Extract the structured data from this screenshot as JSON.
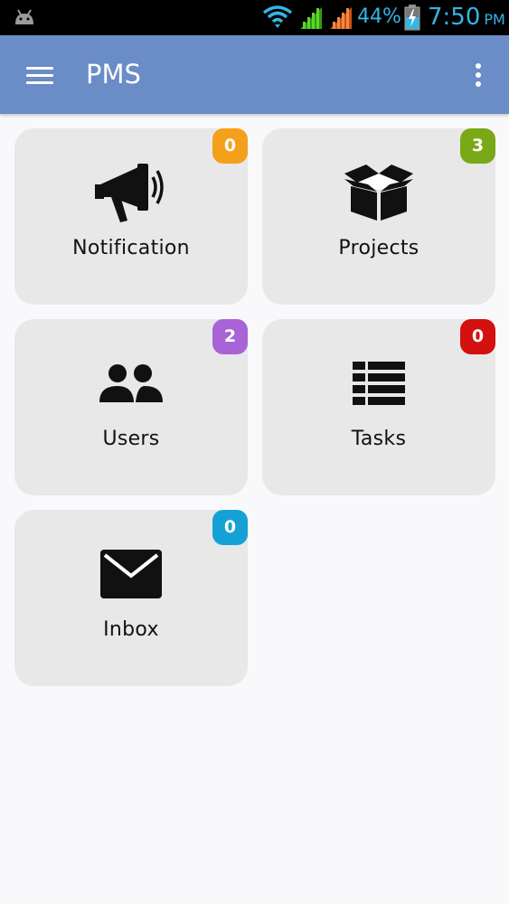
{
  "status_bar": {
    "battery_percent": "44%",
    "time": "7:50",
    "ampm": "PM",
    "icons": [
      "android-icon",
      "wifi-icon",
      "signal-icon",
      "signal-icon",
      "battery-charging-icon"
    ]
  },
  "toolbar": {
    "title": "PMS",
    "menu_icon": "hamburger-menu-icon",
    "overflow_icon": "more-vert-icon",
    "color": "#6a8cc7"
  },
  "tiles": [
    {
      "label": "Notification",
      "badge": "0",
      "badge_color": "#f5a01a",
      "icon": "megaphone-icon"
    },
    {
      "label": "Projects",
      "badge": "3",
      "badge_color": "#7aa817",
      "icon": "open-box-icon"
    },
    {
      "label": "Users",
      "badge": "2",
      "badge_color": "#a864d6",
      "icon": "users-icon"
    },
    {
      "label": "Tasks",
      "badge": "0",
      "badge_color": "#d41010",
      "icon": "list-icon"
    },
    {
      "label": "Inbox",
      "badge": "0",
      "badge_color": "#15a1d6",
      "icon": "envelope-icon"
    }
  ]
}
